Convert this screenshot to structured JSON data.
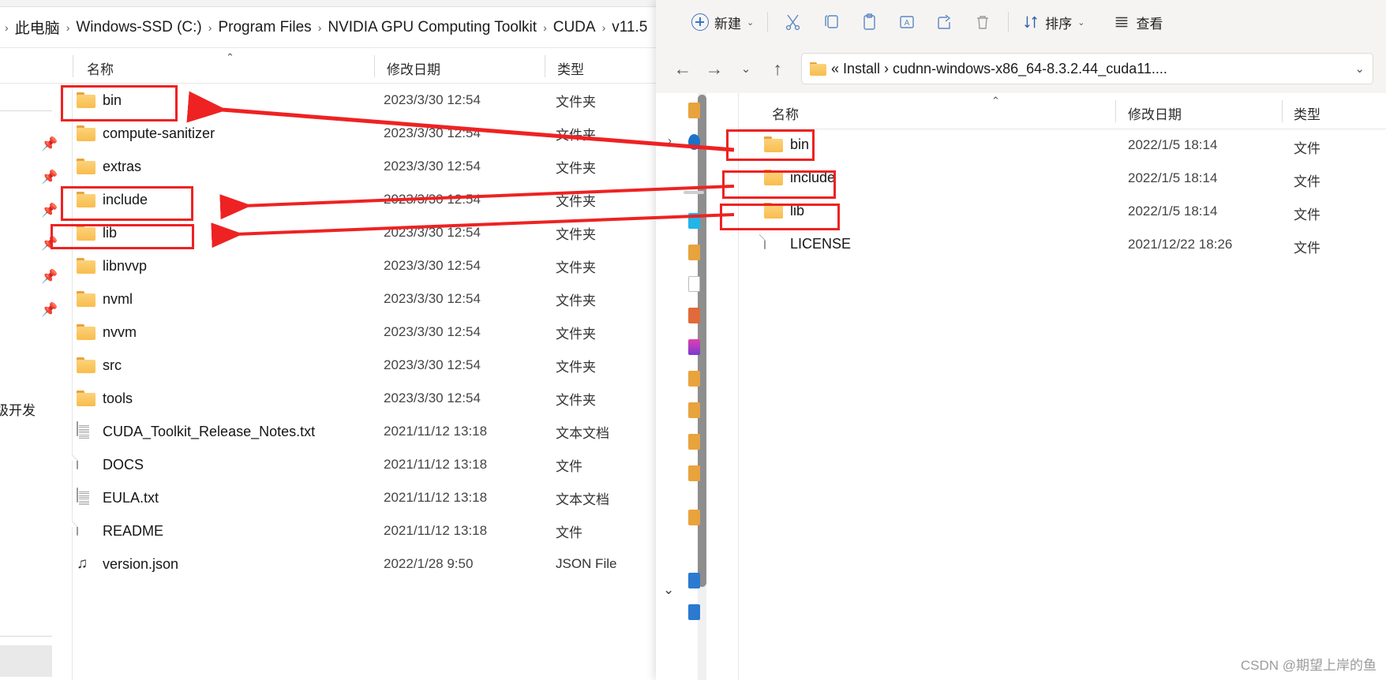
{
  "left_window": {
    "breadcrumb": {
      "leading_sep": "›",
      "items": [
        "此电脑",
        "Windows-SSD (C:)",
        "Program Files",
        "NVIDIA GPU Computing Toolkit",
        "CUDA",
        "v11.5"
      ],
      "separator": "›"
    },
    "columns": {
      "name": "名称",
      "date": "修改日期",
      "type": "类型",
      "sort_indicator": "⌃"
    },
    "nav_pane": {
      "pin_icon_count": 6,
      "pin_icon": "pin-icon",
      "cut_off_label": "级开发"
    },
    "rows": [
      {
        "icon": "folder",
        "name": "bin",
        "date": "2023/3/30 12:54",
        "type": "文件夹",
        "highlighted": true
      },
      {
        "icon": "folder",
        "name": "compute-sanitizer",
        "date": "2023/3/30 12:54",
        "type": "文件夹",
        "highlighted": false
      },
      {
        "icon": "folder",
        "name": "extras",
        "date": "2023/3/30 12:54",
        "type": "文件夹",
        "highlighted": false
      },
      {
        "icon": "folder",
        "name": "include",
        "date": "2023/3/30 12:54",
        "type": "文件夹",
        "highlighted": true
      },
      {
        "icon": "folder",
        "name": "lib",
        "date": "2023/3/30 12:54",
        "type": "文件夹",
        "highlighted": true
      },
      {
        "icon": "folder",
        "name": "libnvvp",
        "date": "2023/3/30 12:54",
        "type": "文件夹",
        "highlighted": false
      },
      {
        "icon": "folder",
        "name": "nvml",
        "date": "2023/3/30 12:54",
        "type": "文件夹",
        "highlighted": false
      },
      {
        "icon": "folder",
        "name": "nvvm",
        "date": "2023/3/30 12:54",
        "type": "文件夹",
        "highlighted": false
      },
      {
        "icon": "folder",
        "name": "src",
        "date": "2023/3/30 12:54",
        "type": "文件夹",
        "highlighted": false
      },
      {
        "icon": "folder",
        "name": "tools",
        "date": "2023/3/30 12:54",
        "type": "文件夹",
        "highlighted": false
      },
      {
        "icon": "text-file",
        "name": "CUDA_Toolkit_Release_Notes.txt",
        "date": "2021/11/12 13:18",
        "type": "文本文档",
        "highlighted": false
      },
      {
        "icon": "file",
        "name": "DOCS",
        "date": "2021/11/12 13:18",
        "type": "文件",
        "highlighted": false
      },
      {
        "icon": "text-file",
        "name": "EULA.txt",
        "date": "2021/11/12 13:18",
        "type": "文本文档",
        "highlighted": false
      },
      {
        "icon": "file",
        "name": "README",
        "date": "2021/11/12 13:18",
        "type": "文件",
        "highlighted": false
      },
      {
        "icon": "json-file",
        "name": "version.json",
        "date": "2022/1/28 9:50",
        "type": "JSON File",
        "highlighted": false
      }
    ]
  },
  "right_window": {
    "toolbar": {
      "new_label": "新建",
      "new_chevron": "⌄",
      "cut_icon": "scissors-icon",
      "copy_icon": "copy-icon",
      "paste_icon": "paste-icon",
      "rename_icon": "rename-icon",
      "share_icon": "share-icon",
      "delete_icon": "trash-icon",
      "sort_label": "排序",
      "sort_chevron": "⌄",
      "view_label": "查看"
    },
    "address": {
      "back_icon": "arrow-left-icon",
      "forward_icon": "arrow-right-icon",
      "recent_chevron": "⌄",
      "up_icon": "arrow-up-icon",
      "folder_icon": "folder-icon",
      "path_prefix": "«",
      "path_items": [
        "Install",
        "cudnn-windows-x86_64-8.3.2.44_cuda11...."
      ],
      "path_separator": "›",
      "dropdown_chevron": "⌄"
    },
    "columns": {
      "name": "名称",
      "date": "修改日期",
      "type": "类型",
      "sort_indicator": "⌃"
    },
    "nav_pane": {
      "expand_chevron": "›",
      "bottom_chevron": "⌄"
    },
    "rows": [
      {
        "icon": "folder",
        "name": "bin",
        "date": "2022/1/5 18:14",
        "type": "文件",
        "highlighted": true
      },
      {
        "icon": "folder",
        "name": "include",
        "date": "2022/1/5 18:14",
        "type": "文件",
        "highlighted": true
      },
      {
        "icon": "folder",
        "name": "lib",
        "date": "2022/1/5 18:14",
        "type": "文件",
        "highlighted": true
      },
      {
        "icon": "file",
        "name": "LICENSE",
        "date": "2021/12/22 18:26",
        "type": "文件",
        "highlighted": false
      }
    ]
  },
  "annotations": {
    "accent_color": "#ee2222",
    "arrow_count": 3,
    "description": "three red arrows pointing from cudnn bin/include/lib to CUDA bin/include/lib"
  },
  "watermark": {
    "text": "CSDN @期望上岸的鱼"
  }
}
